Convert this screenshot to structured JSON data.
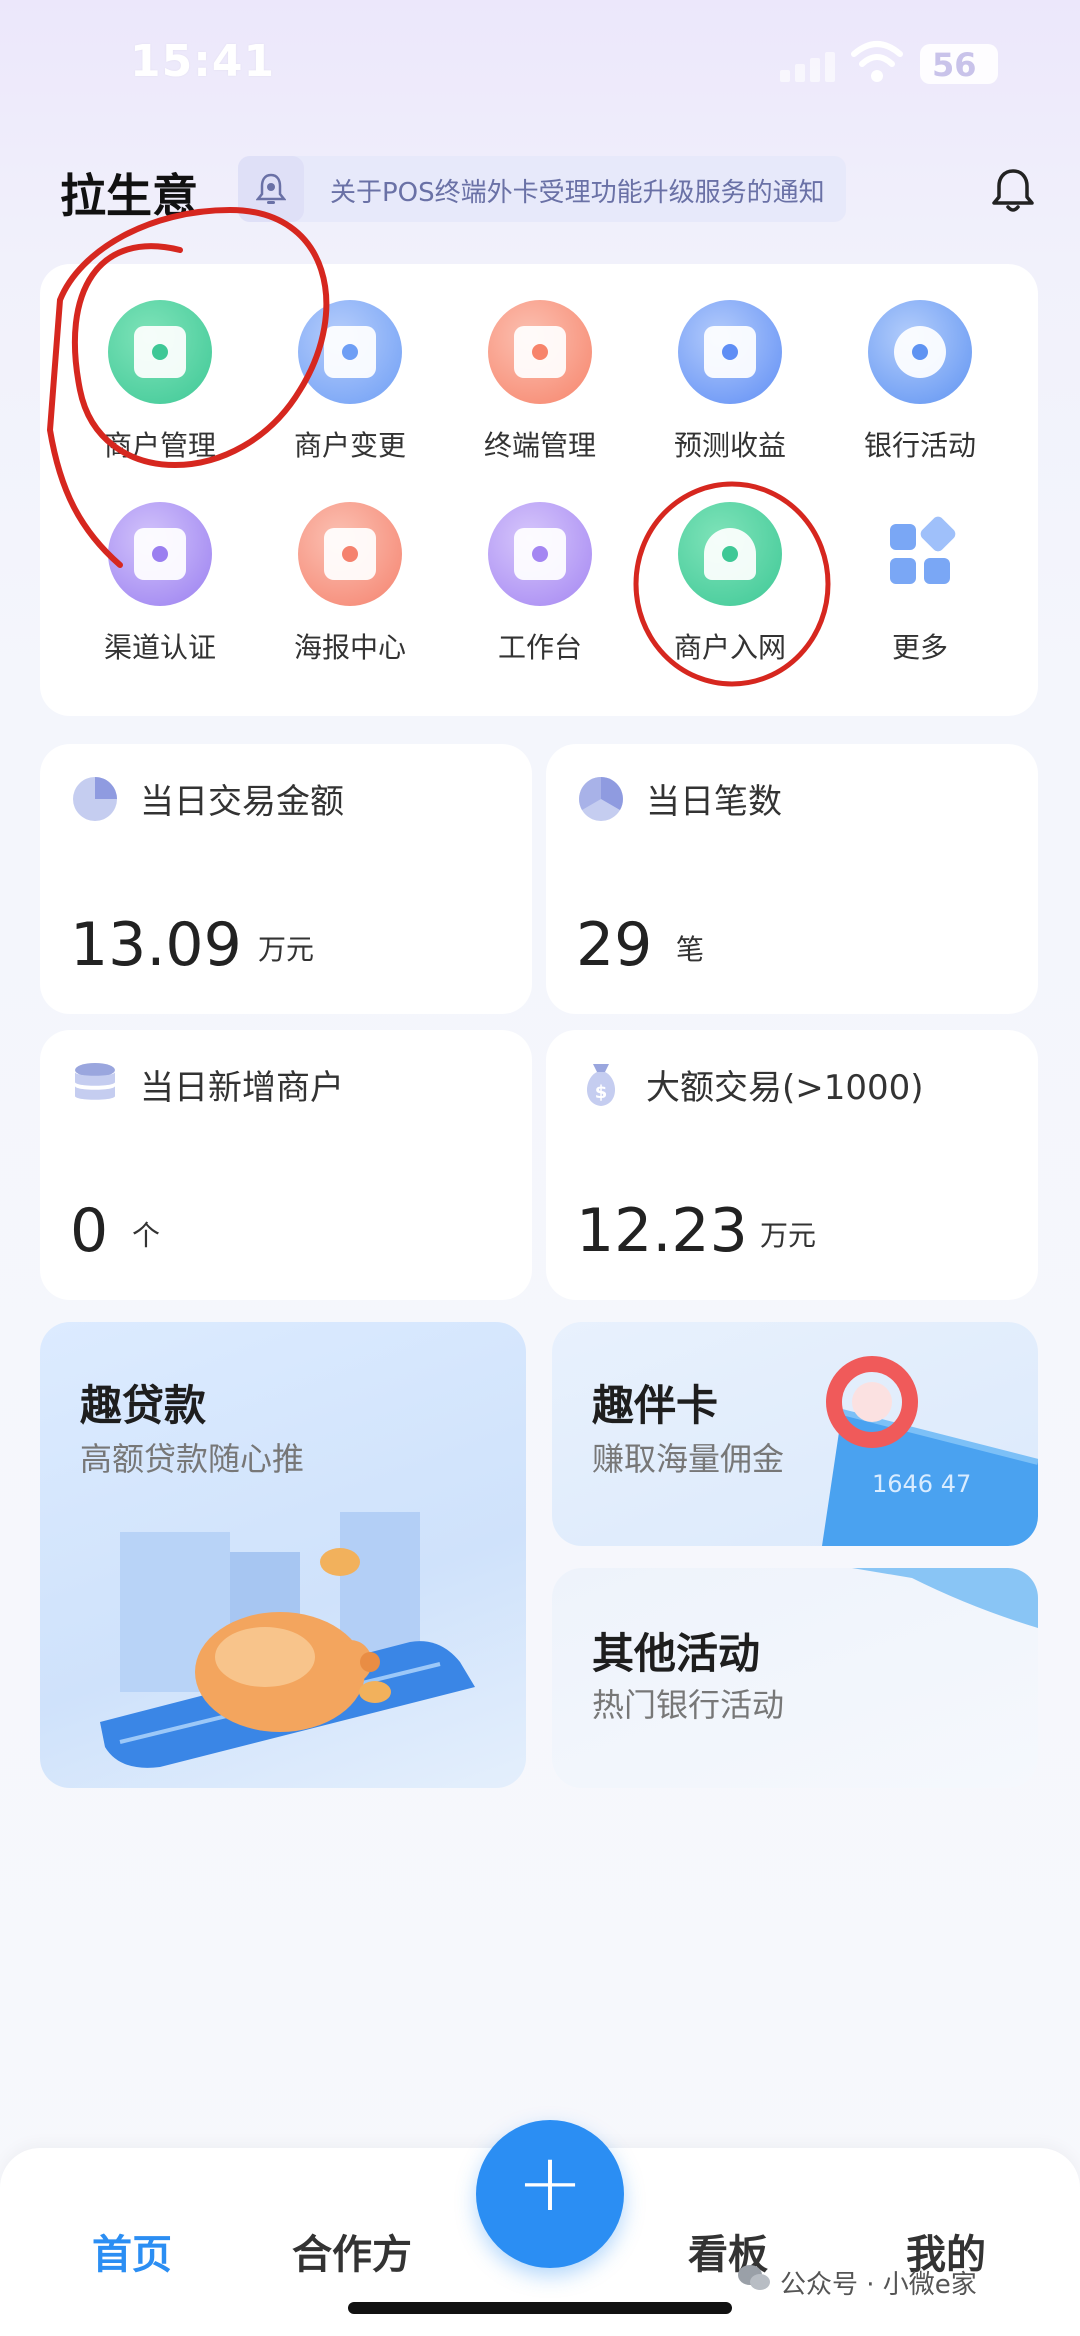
{
  "status_bar": {
    "time": "15:41",
    "battery": "56"
  },
  "header": {
    "title": "拉生意",
    "notice": "关于POS终端外卡受理功能升级服务的通知"
  },
  "functions": [
    {
      "label": "商户管理",
      "color": "#3ec896"
    },
    {
      "label": "商户变更",
      "color": "#6e9ef5"
    },
    {
      "label": "终端管理",
      "color": "#f7846b"
    },
    {
      "label": "预测收益",
      "color": "#5f8ef5"
    },
    {
      "label": "银行活动",
      "color": "#5f93f2"
    },
    {
      "label": "渠道认证",
      "color": "#9a7ff0"
    },
    {
      "label": "海报中心",
      "color": "#f5826e"
    },
    {
      "label": "工作台",
      "color": "#a486f2"
    },
    {
      "label": "商户入网",
      "color": "#3ec896"
    },
    {
      "label": "更多",
      "color": "#5f93f2"
    }
  ],
  "stats": [
    {
      "label": "当日交易金额",
      "value": "13.09",
      "unit": "万元"
    },
    {
      "label": "当日笔数",
      "value": "29",
      "unit": "笔"
    },
    {
      "label": "当日新增商户",
      "value": "0",
      "unit": "个"
    },
    {
      "label": "大额交易(>1000)",
      "value": "12.23",
      "unit": "万元"
    }
  ],
  "promos": {
    "loan": {
      "title": "趣贷款",
      "subtitle": "高额贷款随心推"
    },
    "card": {
      "title": "趣伴卡",
      "subtitle": "赚取海量佣金"
    },
    "other": {
      "title": "其他活动",
      "subtitle": "热门银行活动"
    }
  },
  "nav": {
    "home": "首页",
    "partner": "合作方",
    "add": "+",
    "board": "看板",
    "mine": "我的",
    "active_color": "#2b8ef3"
  },
  "watermark": "公众号 · 小微e家",
  "annotation_color": "#d6271f"
}
